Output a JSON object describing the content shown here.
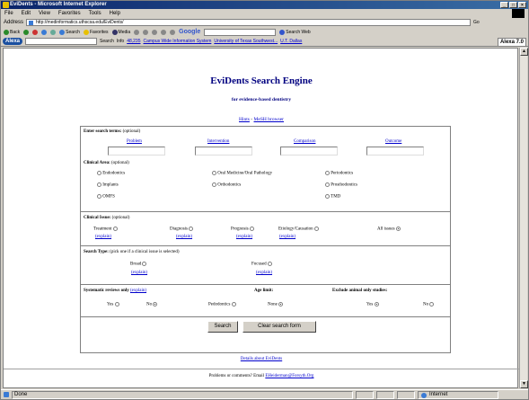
{
  "window": {
    "title": "EviDents - Microsoft Internet Explorer",
    "min": "_",
    "max": "□",
    "close": "×"
  },
  "menu": [
    "File",
    "Edit",
    "View",
    "Favorites",
    "Tools",
    "Help"
  ],
  "address": {
    "label": "Address",
    "url": "http://medinformatics.uthscsa.edu/EviDents/",
    "go": "Go"
  },
  "toolbar": {
    "back": "Back",
    "search": "Search",
    "favorites": "Favorites",
    "media": "Media",
    "google": "Google",
    "search_web": "Search Web"
  },
  "alexa": {
    "logo": "Alexa",
    "search": "Search",
    "info": "Info",
    "rank": "48,235",
    "link1": "Campus Wide Information System",
    "link2": "University of Texas Southwest...",
    "link3": "U.T. Dallas",
    "version": "Alexa 7.0"
  },
  "page": {
    "title": "EviDents Search Engine",
    "subtitle": "for evidence-based dentistry",
    "hints": "Hints",
    "sep": " - ",
    "mesh": "MeSH browser",
    "terms": {
      "label": "Enter search terms:",
      "optional": "(optional)",
      "fields": [
        "Problem",
        "Intervention",
        "Comparison",
        "Outcome"
      ]
    },
    "areas": {
      "label": "Clinical Area:",
      "optional": "(optional)",
      "col1": [
        "Endodontics",
        "Implants",
        "OMFS"
      ],
      "col2": [
        "Oral Medicine/Oral Pathology",
        "Orthodontics"
      ],
      "col3": [
        "Periodontics",
        "Prosthodontics",
        "TMD"
      ]
    },
    "issues": {
      "label": "Clinical Issue:",
      "optional": "(optional)",
      "items": [
        "Treatment",
        "Diagnosis",
        "Prognosis",
        "Etiology/Causation"
      ],
      "explain": "(explain)",
      "all": "All issues"
    },
    "stype": {
      "label": "Search Type:",
      "note": "(pick one if a clinical issue is selected)",
      "broad": "Broad",
      "focused": "Focused",
      "explain": "(explain)"
    },
    "sys": {
      "label": "Systematic reviews only",
      "explain": "(explain)",
      "yes": "Yes",
      "no": "No"
    },
    "age": {
      "label": "Age limit:",
      "pedo": "Pedodontics",
      "none": "None"
    },
    "animal": {
      "label": "Exclude animal only studies:",
      "yes": "Yes",
      "no": "No"
    },
    "search_btn": "Search",
    "clear_btn": "Clear search form",
    "details": "Details about EviDents",
    "footer_text": "Problems or comments? Email",
    "footer_email": "EHeiderman@Forsyth.Org"
  },
  "status": {
    "left": "Done",
    "zone": "Internet"
  }
}
